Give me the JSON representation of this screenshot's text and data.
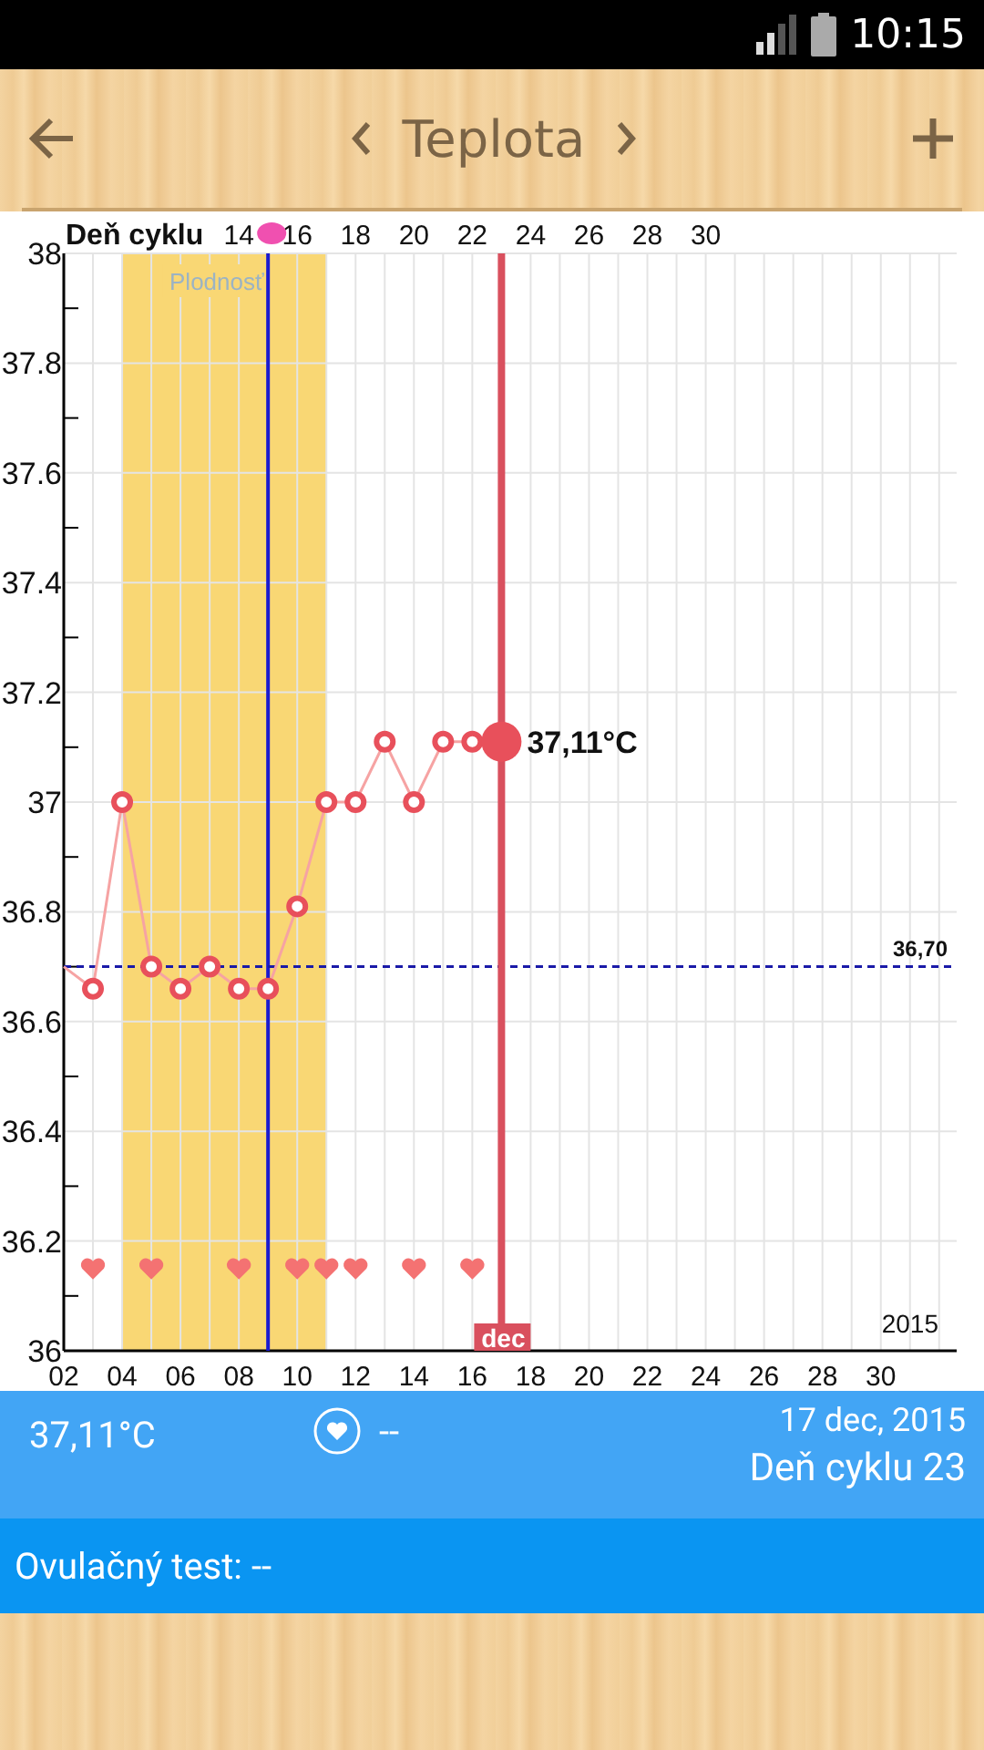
{
  "status_bar": {
    "time": "10:15"
  },
  "toolbar": {
    "title": "Teplota"
  },
  "chart": {
    "cycle_day_axis": {
      "title": "Deň cyklu",
      "labels": [
        "14",
        "16",
        "18",
        "20",
        "22",
        "24",
        "26",
        "28",
        "30"
      ]
    },
    "year": "2015",
    "chart_data": {
      "type": "line",
      "grid": true,
      "x": [
        2,
        3,
        4,
        5,
        6,
        7,
        8,
        9,
        10,
        11,
        12,
        13,
        14,
        15,
        16,
        17
      ],
      "series": [
        {
          "color": "#e8505b",
          "marker": "circle",
          "values": [
            36.7,
            36.66,
            37.0,
            36.7,
            36.66,
            36.7,
            36.66,
            36.66,
            36.81,
            37.0,
            37.0,
            37.11,
            37.0,
            37.11,
            37.11,
            37.11
          ]
        },
        {
          "type": "scatter",
          "color": "#f47272",
          "values": [
            null,
            36.15,
            null,
            36.15,
            null,
            null,
            36.15,
            null,
            36.15,
            36.15,
            36.15,
            null,
            36.15,
            null,
            36.15,
            null
          ]
        }
      ],
      "xlim": [
        2,
        32.6
      ],
      "ylim": [
        36,
        38
      ],
      "xticks": [
        {
          "value": 2,
          "label": "02"
        },
        {
          "value": 4,
          "label": "04"
        },
        {
          "value": 6,
          "label": "06"
        },
        {
          "value": 8,
          "label": "08"
        },
        {
          "value": 10,
          "label": "10"
        },
        {
          "value": 12,
          "label": "12"
        },
        {
          "value": 14,
          "label": "14"
        },
        {
          "value": 16,
          "label": "16"
        },
        {
          "value": 18,
          "label": "18"
        },
        {
          "value": 20,
          "label": "20"
        },
        {
          "value": 22,
          "label": "22"
        },
        {
          "value": 24,
          "label": "24"
        },
        {
          "value": 26,
          "label": "26"
        },
        {
          "value": 28,
          "label": "28"
        },
        {
          "value": 30,
          "label": "30"
        }
      ],
      "yticks": [
        36,
        36.2,
        36.4,
        36.6,
        36.8,
        37,
        37.2,
        37.4,
        37.6,
        37.8,
        38
      ],
      "bands": [
        {
          "axis": "x",
          "from": 4,
          "to": 11,
          "label": "Plodnosť",
          "color": "#f9d774"
        }
      ],
      "ref_lines": [
        {
          "axis": "x",
          "value": 9,
          "color": "#1a1ad0"
        },
        {
          "axis": "y",
          "value": 36.7,
          "label": "36,70",
          "color": "#1a1aa8"
        },
        {
          "axis": "x",
          "value": 17,
          "label": "dec",
          "color": "#d9505e"
        }
      ],
      "annotations": [
        {
          "text": "37,11°C",
          "x": 17,
          "y": 37.11
        }
      ]
    }
  },
  "summary": {
    "temperature": "37,11°C",
    "intercourse": "--",
    "date": "17 dec, 2015",
    "cycle_day": "Deň cyklu 23"
  },
  "ovulation_test": {
    "label": "Ovulačný test: --"
  }
}
